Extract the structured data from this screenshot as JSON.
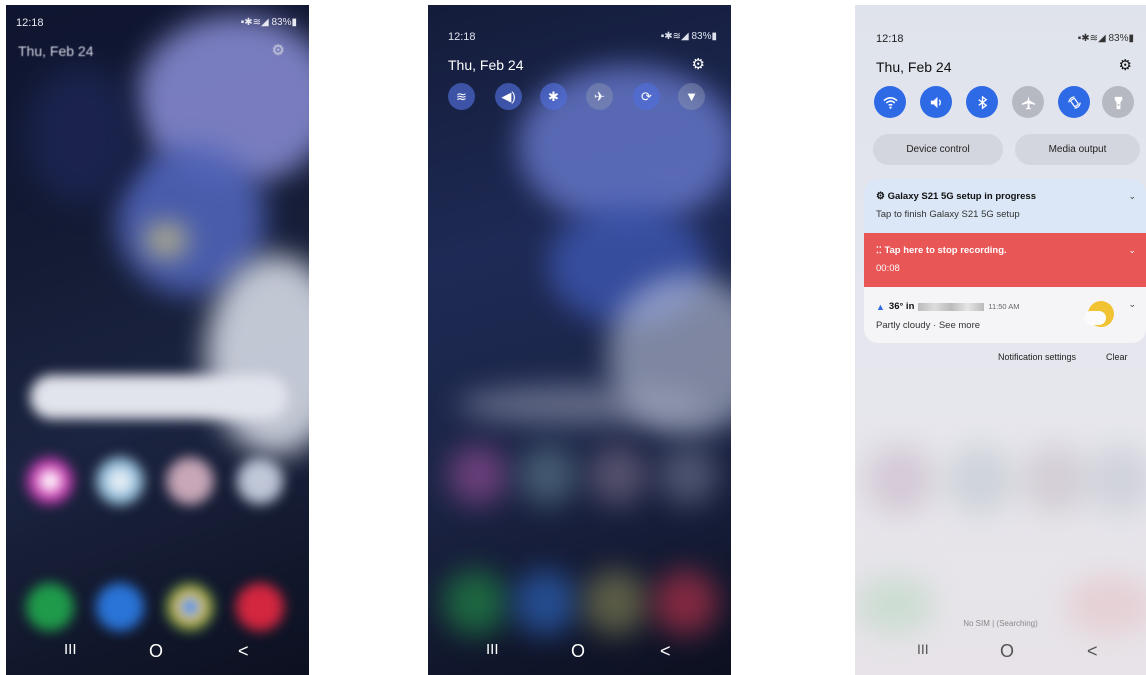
{
  "status": {
    "time": "12:18",
    "battery": "83%"
  },
  "panel": {
    "date": "Thu, Feb 24"
  },
  "quick_settings": [
    {
      "icon": "wifi-icon",
      "active": true
    },
    {
      "icon": "sound-icon",
      "active": true
    },
    {
      "icon": "bluetooth-icon",
      "active": true
    },
    {
      "icon": "airplane-icon",
      "active": false
    },
    {
      "icon": "auto-rotate-icon",
      "active": true
    },
    {
      "icon": "flashlight-icon",
      "active": false
    }
  ],
  "pills": {
    "device_control": "Device control",
    "media_output": "Media output"
  },
  "notifications": {
    "setup": {
      "title": "Galaxy S21 5G setup in progress",
      "body": "Tap to finish Galaxy S21 5G setup"
    },
    "recording": {
      "title": "Tap here to stop recording.",
      "time": "00:08"
    },
    "weather": {
      "temp": "36° in",
      "time": "11:50 AM",
      "body": "Partly cloudy · See more"
    }
  },
  "actions": {
    "settings": "Notification settings",
    "clear": "Clear"
  },
  "footer": {
    "sim": "No SIM | (Searching)"
  },
  "nav": {
    "recents": "III",
    "home": "O",
    "back": "<"
  },
  "colors": {
    "accent": "#2f6ae6",
    "recording": "#e85656",
    "setup_bg": "#dbe7f6"
  }
}
